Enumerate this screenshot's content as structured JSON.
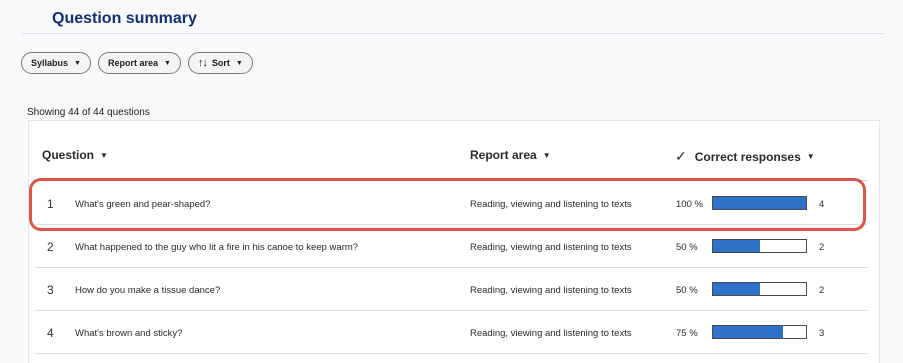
{
  "page": {
    "title": "Question summary"
  },
  "filters": {
    "syllabus_label": "Syllabus",
    "report_area_label": "Report area",
    "sort_label": "Sort"
  },
  "summary": {
    "showing_text": "Showing 44 of 44 questions"
  },
  "table": {
    "columns": {
      "question": "Question",
      "report_area": "Report area",
      "correct": "Correct responses"
    },
    "rows": [
      {
        "num": "1",
        "question": "What's green and pear-shaped?",
        "area": "Reading, viewing and listening to texts",
        "pct_text": "100 %",
        "pct": 100,
        "count": "4"
      },
      {
        "num": "2",
        "question": "What happened to the guy who lit a fire in his canoe to keep warm?",
        "area": "Reading, viewing and listening to texts",
        "pct_text": "50 %",
        "pct": 50,
        "count": "2"
      },
      {
        "num": "3",
        "question": "How do you make a tissue dance?",
        "area": "Reading, viewing and listening to texts",
        "pct_text": "50 %",
        "pct": 50,
        "count": "2"
      },
      {
        "num": "4",
        "question": "What's brown and sticky?",
        "area": "Reading, viewing and listening to texts",
        "pct_text": "75 %",
        "pct": 75,
        "count": "3"
      }
    ]
  },
  "icons": {
    "caret": "caret-down-icon",
    "sort": "sort-arrows-icon",
    "check": "checkmark-icon"
  },
  "colors": {
    "accent": "#2e72c8",
    "title": "#16306b",
    "highlight": "#d7574b"
  }
}
